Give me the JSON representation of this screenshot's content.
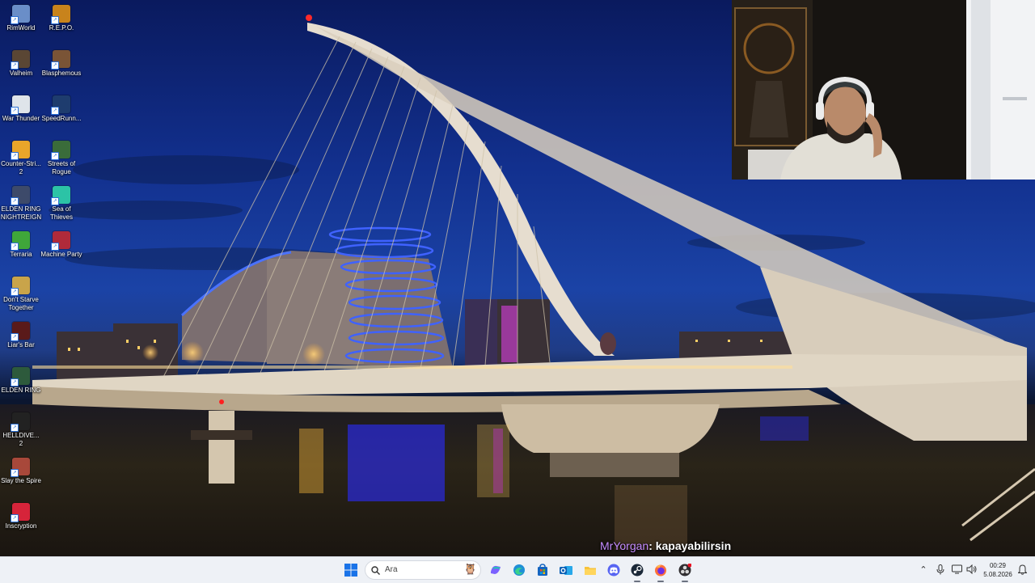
{
  "desktop": {
    "icons": [
      {
        "label": "RimWorld",
        "icon": "rimworld-icon",
        "color": "#6a8ec8"
      },
      {
        "label": "R.E.P.O.",
        "icon": "repo-icon",
        "color": "#c8831c"
      },
      {
        "label": "Valheim",
        "icon": "valheim-icon",
        "color": "#5a4634"
      },
      {
        "label": "Blasphemous",
        "icon": "blasphemous-icon",
        "color": "#7a5436"
      },
      {
        "label": "War Thunder",
        "icon": "war-thunder-icon",
        "color": "#dfe4ea"
      },
      {
        "label": "SpeedRunn...",
        "icon": "speedrunners-icon",
        "color": "#1e3c6e"
      },
      {
        "label": "Counter-Stri... 2",
        "icon": "counter-strike-icon",
        "color": "#e9a52a"
      },
      {
        "label": "Streets of Rogue",
        "icon": "streets-of-rogue-icon",
        "color": "#3a6c3a"
      },
      {
        "label": "ELDEN RING NIGHTREIGN",
        "icon": "elden-ring-nightreign-icon",
        "color": "#3d4a6a"
      },
      {
        "label": "Sea of Thieves",
        "icon": "sea-of-thieves-icon",
        "color": "#2cc3a6"
      },
      {
        "label": "Terraria",
        "icon": "terraria-icon",
        "color": "#3fa63a"
      },
      {
        "label": "Machine Party",
        "icon": "machine-party-icon",
        "color": "#b02a3a"
      },
      {
        "label": "Don't Starve Together",
        "icon": "dont-starve-together-icon",
        "color": "#c9a44a"
      },
      {
        "label": "Liar's Bar",
        "icon": "liars-bar-icon",
        "color": "#5a1a1a"
      },
      {
        "label": "ELDEN RING",
        "icon": "elden-ring-icon",
        "color": "#2d5a3c"
      },
      {
        "label": "HELLDIVE... 2",
        "icon": "helldivers-icon",
        "color": "#222222"
      },
      {
        "label": "Slay the Spire",
        "icon": "slay-the-spire-icon",
        "color": "#a8483a"
      },
      {
        "label": "Inscryption",
        "icon": "inscryption-icon",
        "color": "#d6243a"
      }
    ]
  },
  "chat": {
    "username": "MrYorgan",
    "message": ": kapayabilirsin",
    "username_color": "#c58cff"
  },
  "taskbar": {
    "search_label": "Ara",
    "pinned": [
      {
        "icon": "windows-start-icon"
      },
      {
        "icon": "search-icon"
      },
      {
        "icon": "copilot-icon"
      },
      {
        "icon": "edge-browser-icon"
      },
      {
        "icon": "microsoft-store-icon"
      },
      {
        "icon": "outlook-icon"
      },
      {
        "icon": "file-explorer-icon"
      },
      {
        "icon": "discord-icon"
      },
      {
        "icon": "steam-icon"
      },
      {
        "icon": "firefox-icon"
      },
      {
        "icon": "obs-icon"
      }
    ],
    "tray": [
      {
        "icon": "chevron-up-icon"
      },
      {
        "icon": "microphone-icon"
      },
      {
        "icon": "display-icon"
      },
      {
        "icon": "speaker-icon"
      },
      {
        "icon": "notification-bell-icon"
      }
    ],
    "clock": {
      "time": "00:29",
      "date": "5.08.2026"
    }
  }
}
